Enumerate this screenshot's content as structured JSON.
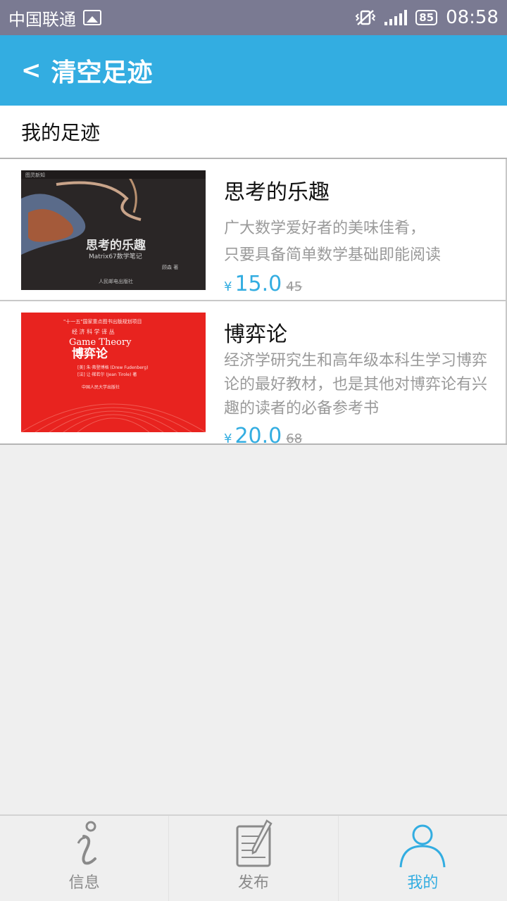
{
  "status_bar": {
    "carrier": "中国联通",
    "battery": "85",
    "time": "08:58"
  },
  "header": {
    "back_label": "<",
    "title": "清空足迹"
  },
  "section": {
    "title": "我的足迹"
  },
  "items": [
    {
      "title": "思考的乐趣",
      "desc_lines": [
        "广大数学爱好者的美味佳肴，",
        "只要具备简单数学基础即能阅读"
      ],
      "currency": "¥",
      "price": "15.0",
      "old_price": "45",
      "cover_title": "思考的乐趣",
      "cover_subtitle": "Matrix67数学笔记",
      "cover_author": "顾森 著"
    },
    {
      "title": "博弈论",
      "desc_lines": [
        "经济学研究生和高年级本科生学习博弈",
        "论的最好教材，也是其他对博弈论有兴",
        "趣的读者的必备参考书"
      ],
      "currency": "¥",
      "price": "20.0",
      "old_price": "68",
      "cover_series": "经 济 科 学 译 丛",
      "cover_en": "Game Theory",
      "cover_title": "博弈论"
    }
  ],
  "tabs": [
    {
      "label": "信息",
      "icon": "info-icon"
    },
    {
      "label": "发布",
      "icon": "publish-icon"
    },
    {
      "label": "我的",
      "icon": "profile-icon"
    }
  ],
  "colors": {
    "accent": "#33ade1",
    "status_bar": "#7a7a92"
  }
}
